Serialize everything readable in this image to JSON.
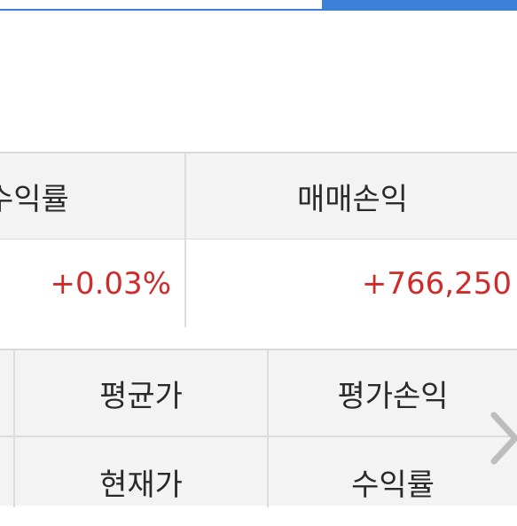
{
  "summary": {
    "headers": {
      "return_rate": "수익률",
      "trading_pnl": "매매손익"
    },
    "values": {
      "return_rate": "+0.03%",
      "trading_pnl": "+766,250"
    }
  },
  "grid": {
    "row1": {
      "avg_price": "평균가",
      "eval_pnl": "평가손익"
    },
    "row2": {
      "current_price": "현재가",
      "return_rate": "수익률"
    }
  },
  "colors": {
    "accent": "#3c7fd9",
    "positive": "#d02b2b",
    "header_bg": "#f3f3f3"
  },
  "icons": {
    "scroll_right": "chevron-right-icon"
  }
}
